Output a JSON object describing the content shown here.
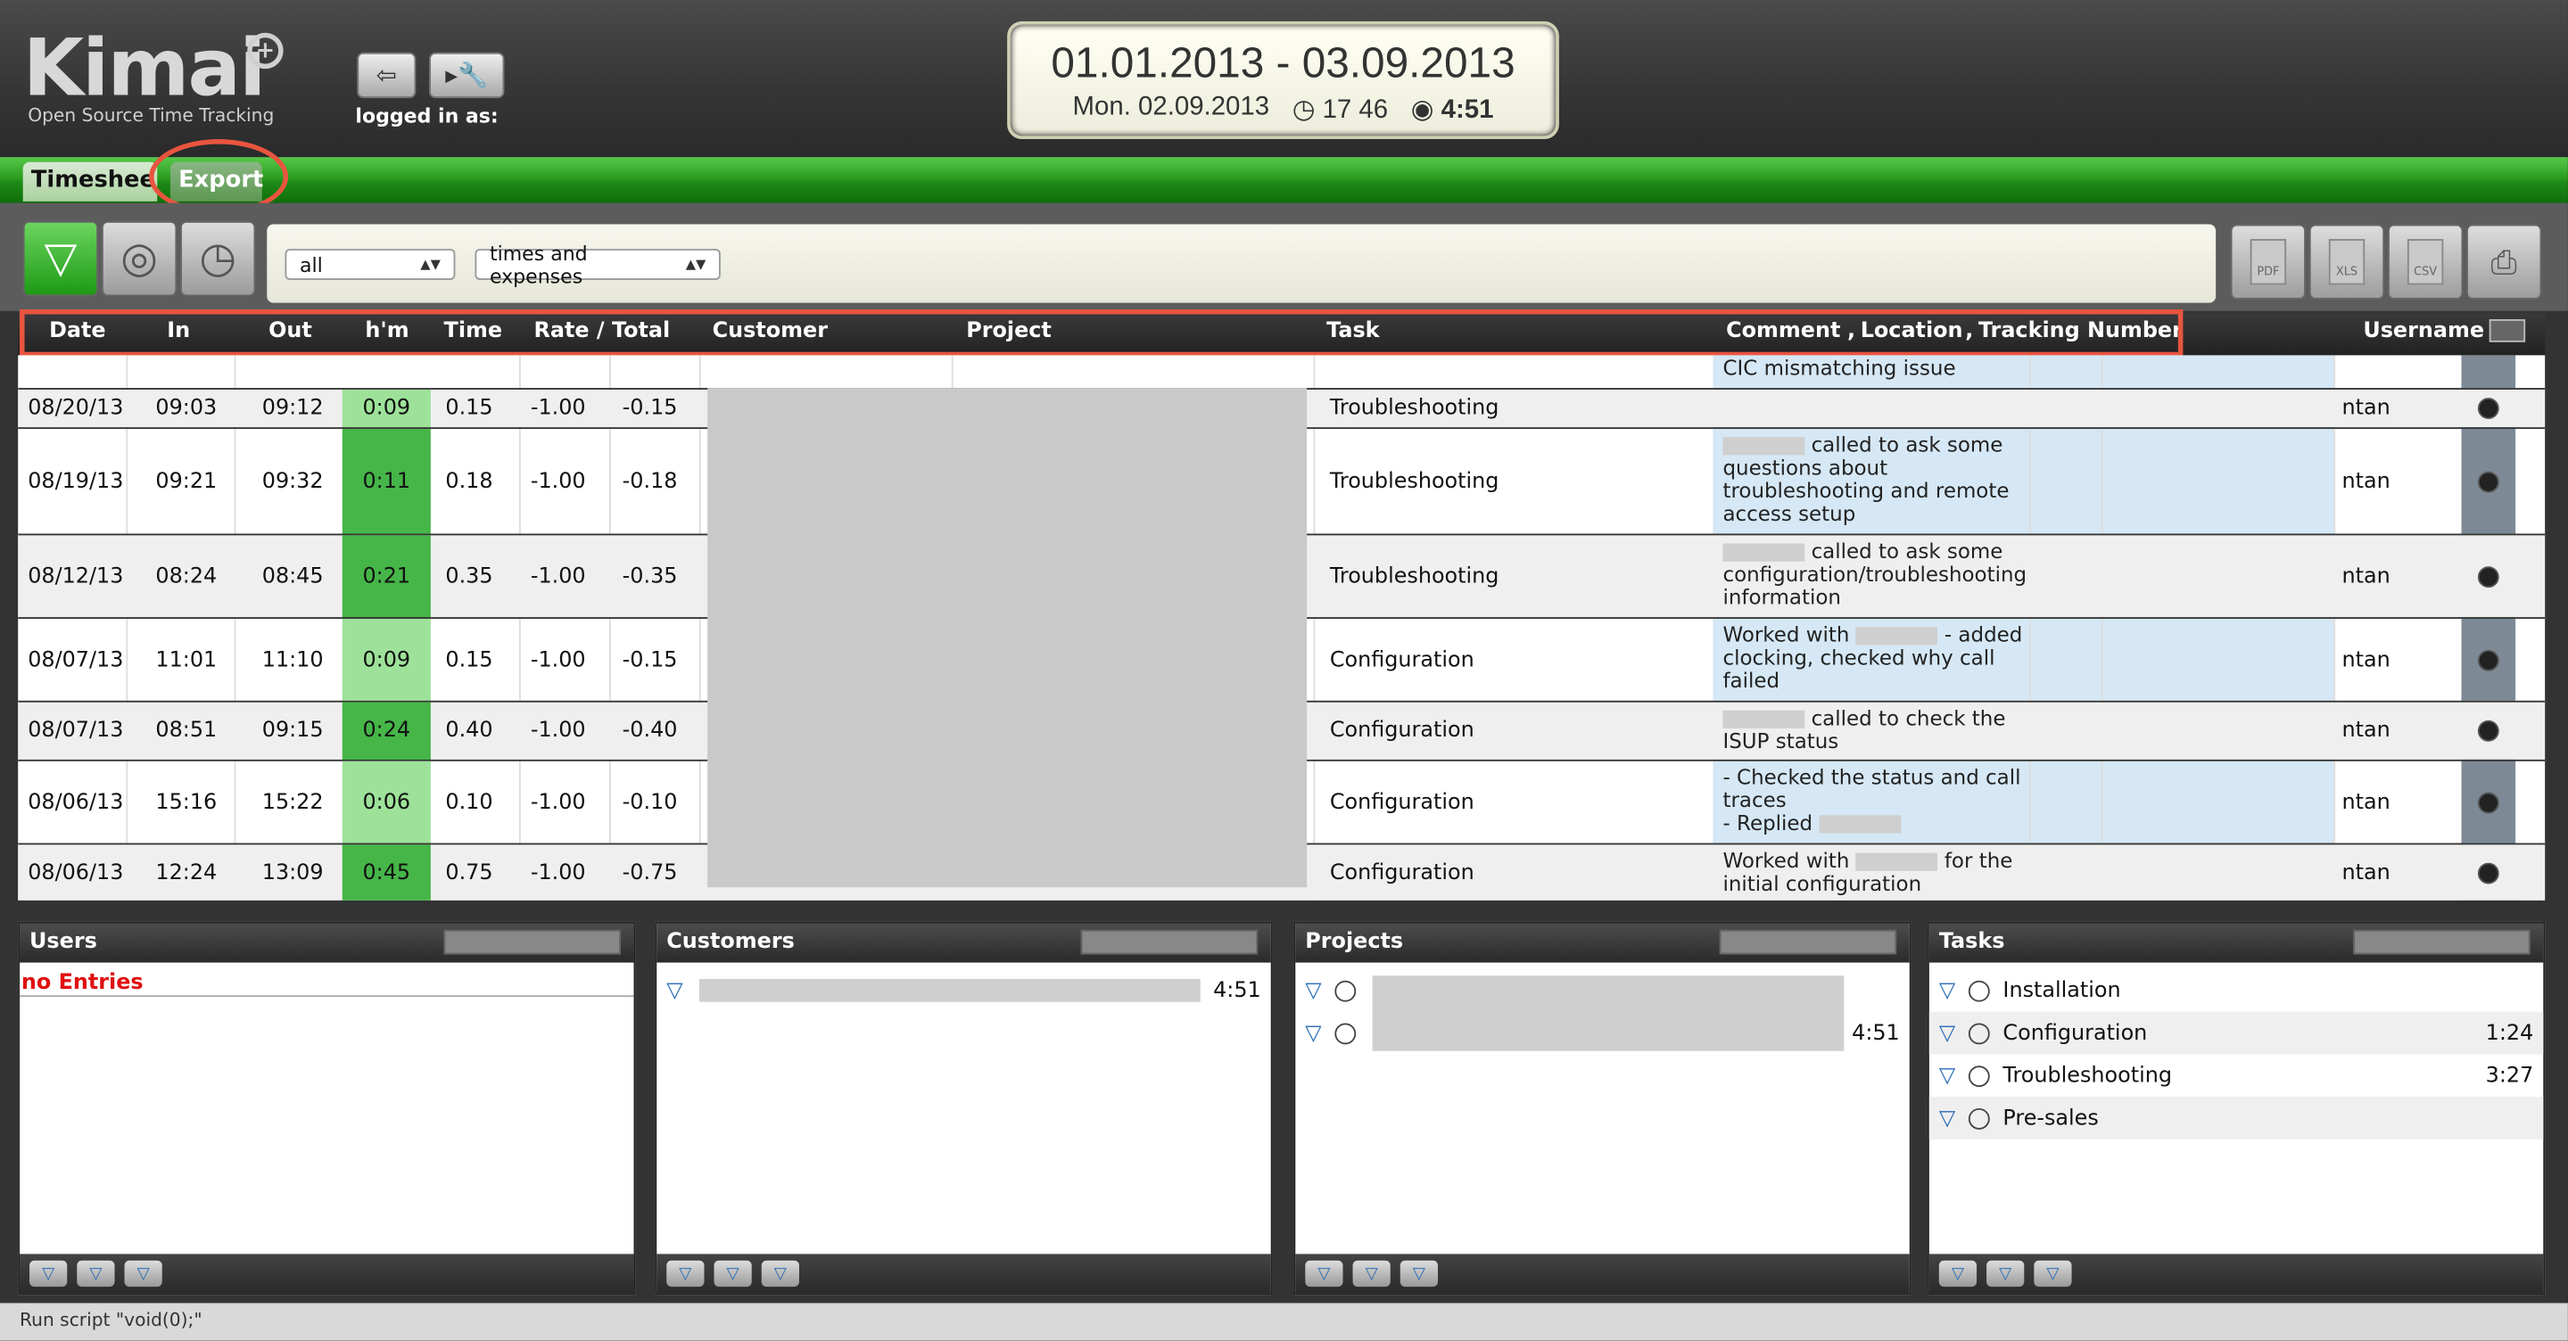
{
  "header": {
    "logo": "Kimai",
    "tagline": "Open Source Time Tracking",
    "logged_in": "logged in as:",
    "date_range": "01.01.2013 - 03.09.2013",
    "today": "Mon. 02.09.2013",
    "time_now": "17 46",
    "total_time": "4:51"
  },
  "tabs": [
    {
      "label": "Timeshee"
    },
    {
      "label": "Export"
    }
  ],
  "toolbar": {
    "filter_select": "all",
    "type_select": "times and expenses",
    "export_buttons": [
      "PDF",
      "XLS",
      "CSV"
    ]
  },
  "table": {
    "columns": {
      "date": "Date",
      "in": "In",
      "out": "Out",
      "hm": "h'm",
      "time": "Time",
      "rate_total": "Rate / Total",
      "customer": "Customer",
      "project": "Project",
      "task": "Task",
      "comment": "Comment",
      "location": "Location",
      "tracking": "Tracking Number",
      "username": "Username"
    },
    "top_comment": "CIC mismatching issue",
    "rows": [
      {
        "date": "08/20/13",
        "in": "09:03",
        "out": "09:12",
        "hm": "0:09",
        "time": "0.15",
        "rate": "-1.00",
        "total": "-0.15",
        "task": "Troubleshooting",
        "comment": "",
        "user": "ntan"
      },
      {
        "date": "08/19/13",
        "in": "09:21",
        "out": "09:32",
        "hm": "0:11",
        "time": "0.18",
        "rate": "-1.00",
        "total": "-0.18",
        "task": "Troubleshooting",
        "comment": "called to ask some questions about troubleshooting and remote access setup",
        "user": "ntan"
      },
      {
        "date": "08/12/13",
        "in": "08:24",
        "out": "08:45",
        "hm": "0:21",
        "time": "0.35",
        "rate": "-1.00",
        "total": "-0.35",
        "task": "Troubleshooting",
        "comment": "called to ask some configuration/troubleshooting information",
        "user": "ntan"
      },
      {
        "date": "08/07/13",
        "in": "11:01",
        "out": "11:10",
        "hm": "0:09",
        "time": "0.15",
        "rate": "-1.00",
        "total": "-0.15",
        "task": "Configuration",
        "comment_a": "Worked with",
        "comment_b": "- added clocking, checked why call failed",
        "user": "ntan"
      },
      {
        "date": "08/07/13",
        "in": "08:51",
        "out": "09:15",
        "hm": "0:24",
        "time": "0.40",
        "rate": "-1.00",
        "total": "-0.40",
        "task": "Configuration",
        "comment": "called to check the ISUP status",
        "user": "ntan"
      },
      {
        "date": "08/06/13",
        "in": "15:16",
        "out": "15:22",
        "hm": "0:06",
        "time": "0.10",
        "rate": "-1.00",
        "total": "-0.10",
        "task": "Configuration",
        "comment_a": "- Checked the status and call traces",
        "comment_b": "- Replied",
        "user": "ntan"
      },
      {
        "date": "08/06/13",
        "in": "12:24",
        "out": "13:09",
        "hm": "0:45",
        "time": "0.75",
        "rate": "-1.00",
        "total": "-0.75",
        "task": "Configuration",
        "comment_a": "Worked with",
        "comment_b": "for the initial configuration",
        "user": "ntan"
      }
    ]
  },
  "panels": {
    "users": {
      "title": "Users",
      "empty": "no Entries"
    },
    "customers": {
      "title": "Customers",
      "total": "4:51"
    },
    "projects": {
      "title": "Projects",
      "total": "4:51"
    },
    "tasks": {
      "title": "Tasks",
      "items": [
        {
          "name": "Installation",
          "time": ""
        },
        {
          "name": "Configuration",
          "time": "1:24"
        },
        {
          "name": "Troubleshooting",
          "time": "3:27"
        },
        {
          "name": "Pre-sales",
          "time": ""
        }
      ]
    }
  },
  "status_bar": "Run script \"void(0);\"",
  "colors": {
    "accent_green": "#2a9d20",
    "annotation": "#e8553f",
    "comment_blue": "#d6e8f5"
  }
}
